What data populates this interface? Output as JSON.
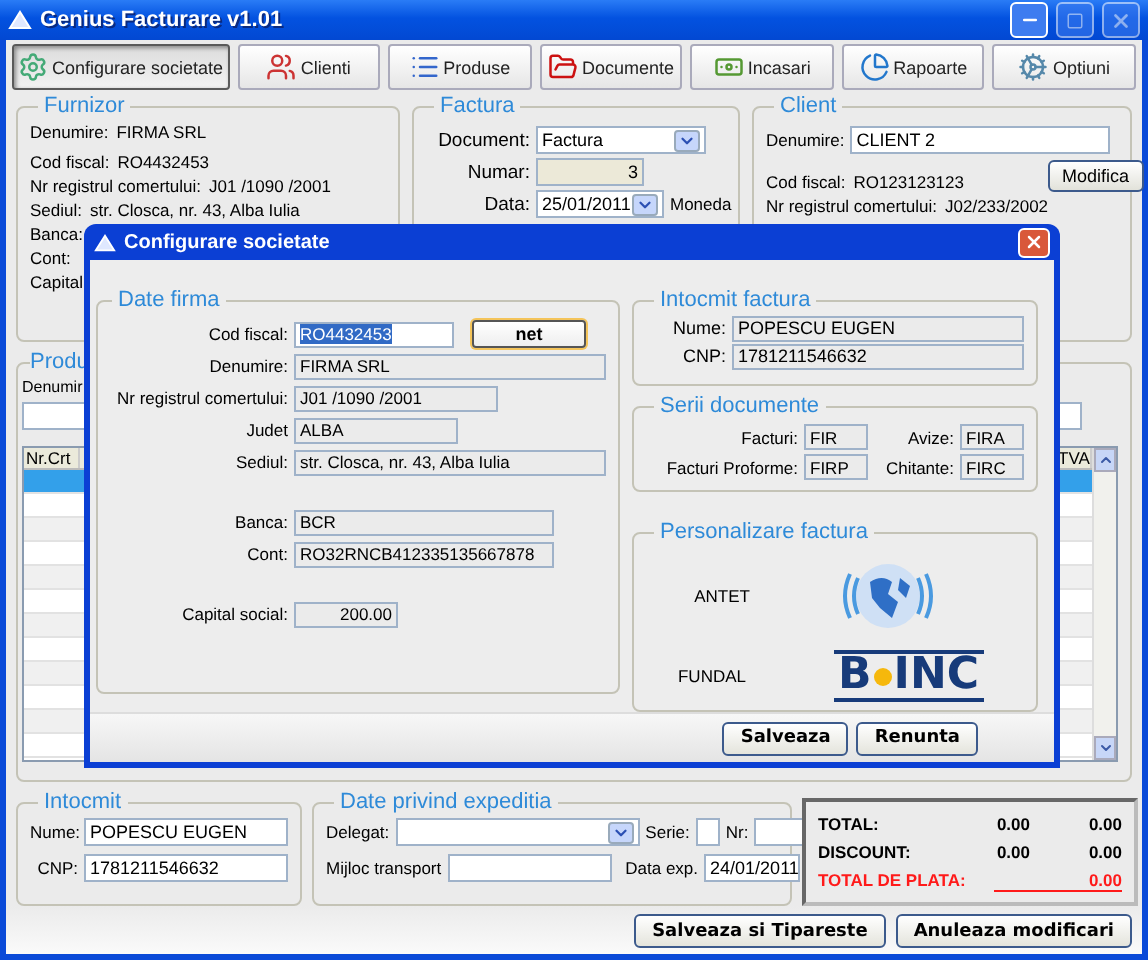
{
  "window": {
    "title": "Genius Facturare v1.01"
  },
  "toolbar": [
    {
      "label": "Configurare societate",
      "pressed": true
    },
    {
      "label": "Clienti",
      "pressed": false
    },
    {
      "label": "Produse",
      "pressed": false
    },
    {
      "label": "Documente",
      "pressed": false
    },
    {
      "label": "Incasari",
      "pressed": false
    },
    {
      "label": "Rapoarte",
      "pressed": false
    },
    {
      "label": "Optiuni",
      "pressed": false
    }
  ],
  "furnizor": {
    "title": "Furnizor",
    "rows": [
      {
        "label": "Denumire:",
        "value": "FIRMA SRL"
      },
      {
        "label": "Cod fiscal:",
        "value": "RO4432453"
      },
      {
        "label": "Nr registrul comertului:",
        "value": "J01 /1090 /2001"
      },
      {
        "label": "Sediul:",
        "value": "str. Closca, nr. 43, Alba Iulia"
      },
      {
        "label": "Banca:"
      },
      {
        "label": "Cont:"
      },
      {
        "label": "Capital"
      }
    ]
  },
  "factura": {
    "title": "Factura",
    "document": {
      "label": "Document:",
      "value": "Factura"
    },
    "numar": {
      "label": "Numar:",
      "value": "3"
    },
    "data": {
      "label": "Data:",
      "value": "25/01/2011"
    },
    "moneda": "Moneda"
  },
  "client": {
    "title": "Client",
    "denumire": {
      "label": "Denumire:",
      "value": "CLIENT 2"
    },
    "button": "Modifica",
    "rows": [
      {
        "label": "Cod fiscal:",
        "value": "RO123123123"
      },
      {
        "label": "Nr registrul comertului:",
        "value": "J02/233/2002"
      }
    ]
  },
  "produse": {
    "title": "Produ",
    "search_label": "Denumir",
    "columns": [
      "Nr.Crt",
      "TVA"
    ],
    "rows": [
      {
        "selected": true
      },
      {
        "selected": false
      },
      {
        "selected": false
      },
      {
        "selected": false
      },
      {
        "selected": false
      },
      {
        "selected": false
      },
      {
        "selected": false
      },
      {
        "selected": false
      },
      {
        "selected": false
      },
      {
        "selected": false
      },
      {
        "selected": false
      },
      {
        "selected": false
      }
    ]
  },
  "intocmit": {
    "title": "Intocmit",
    "fields": [
      {
        "label": "Nume:",
        "value": "POPESCU EUGEN"
      },
      {
        "label": "CNP:",
        "value": "1781211546632"
      }
    ]
  },
  "expeditie": {
    "title": "Date privind expeditia",
    "delegat": "Delegat:",
    "serie": "Serie:",
    "nr": "Nr:",
    "mijloc": "Mijloc transport",
    "data": {
      "label": "Data exp.",
      "value": "24/01/2011"
    }
  },
  "totals": [
    {
      "kind": "normal",
      "label": "TOTAL:",
      "values": [
        "0.00",
        "0.00"
      ]
    },
    {
      "kind": "normal",
      "label": "DISCOUNT:",
      "values": [
        "0.00",
        "0.00"
      ]
    },
    {
      "kind": "grand",
      "label": "TOTAL DE PLATA:",
      "values": [
        "0.00"
      ]
    }
  ],
  "actions": [
    "Salveaza si Tipareste",
    "Anuleaza modificari"
  ],
  "dialog": {
    "title": "Configurare societate",
    "firma": {
      "title": "Date firma",
      "check_button": "net",
      "sections": [
        {
          "rows": [
            {
              "label": "Cod fiscal:",
              "value": "RO4432453",
              "editable": true,
              "highlighted": true
            },
            {
              "label": "Denumire:",
              "value": "FIRMA SRL",
              "editable": false,
              "highlighted": false
            },
            {
              "label": "Nr registrul comertului:",
              "value": "J01 /1090 /2001",
              "editable": false,
              "highlighted": false
            },
            {
              "label": "Judet",
              "value": "ALBA",
              "editable": false,
              "highlighted": false
            },
            {
              "label": "Sediul:",
              "value": "str. Closca, nr. 43, Alba Iulia",
              "editable": false,
              "highlighted": false
            }
          ]
        },
        {
          "rows": [
            {
              "label": "Banca:",
              "value": "BCR",
              "editable": false,
              "highlighted": false
            },
            {
              "label": "Cont:",
              "value": "RO32RNCB412335135667878",
              "editable": false,
              "highlighted": false
            }
          ]
        },
        {
          "rows": [
            {
              "label": "Capital social:",
              "value": "200.00",
              "editable": false,
              "highlighted": false
            }
          ]
        }
      ]
    },
    "intocmit": {
      "title": "Intocmit factura",
      "rows": [
        {
          "label": "Nume:",
          "value": "POPESCU EUGEN"
        },
        {
          "label": "CNP:",
          "value": "1781211546632"
        }
      ]
    },
    "serii": {
      "title": "Serii documente",
      "items": [
        {
          "label": "Facturi:",
          "value": "FIR"
        },
        {
          "label": "Avize:",
          "value": "FIRA"
        },
        {
          "label": "Facturi Proforme:",
          "value": "FIRP"
        },
        {
          "label": "Chitante:",
          "value": "FIRC"
        }
      ]
    },
    "personalizare": {
      "title": "Personalizare factura",
      "antet": "ANTET",
      "fundal": "FUNDAL",
      "logo_left": "B",
      "logo_right": "INC"
    },
    "buttons": [
      "Salveaza",
      "Renunta"
    ]
  }
}
